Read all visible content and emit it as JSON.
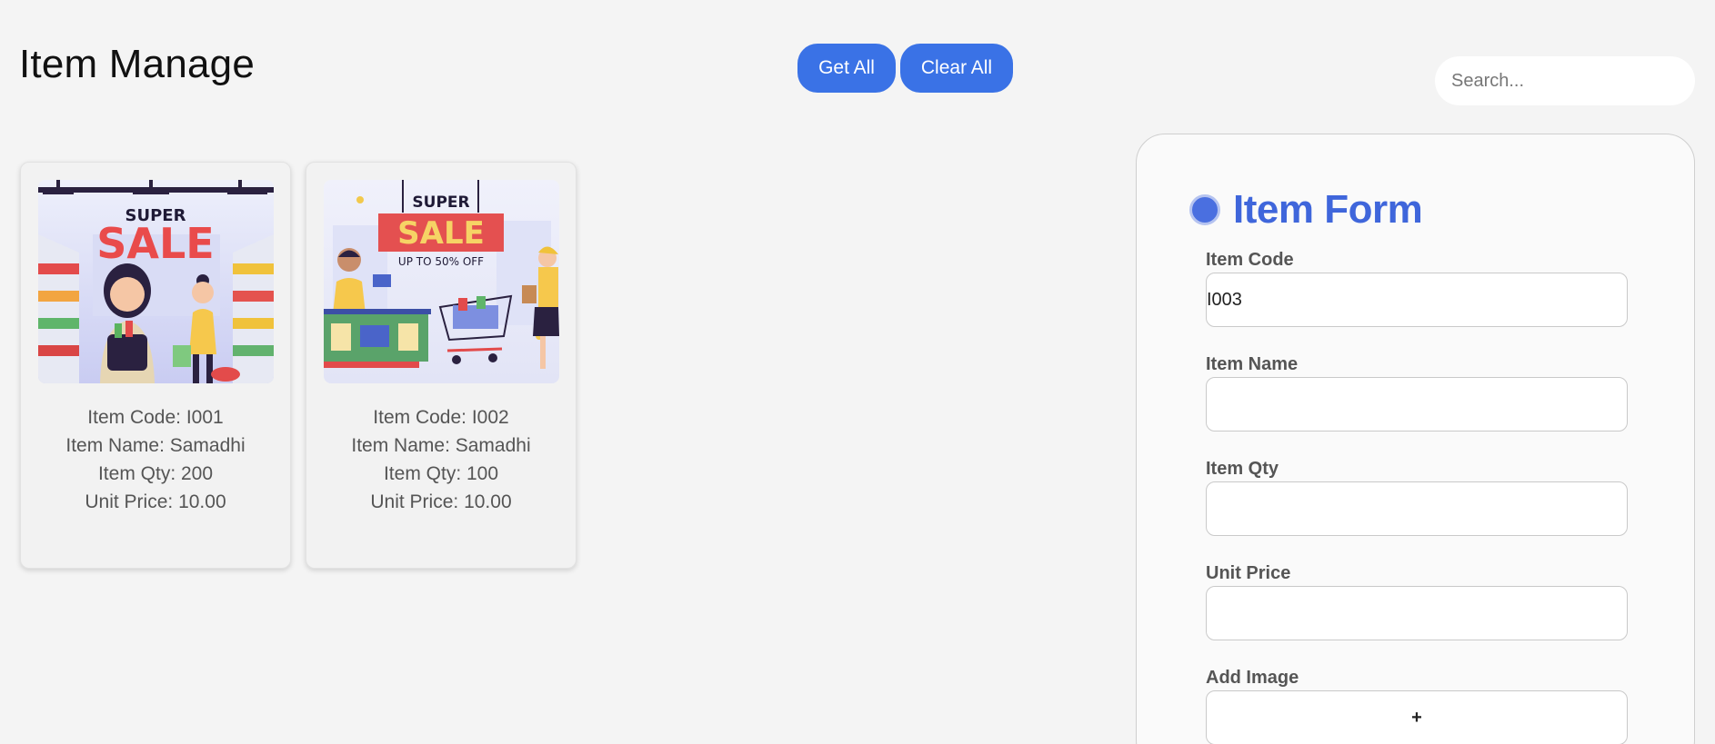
{
  "header": {
    "title": "Item Manage",
    "get_all_label": "Get All",
    "clear_all_label": "Clear All"
  },
  "search": {
    "placeholder": "Search...",
    "icon": "search-icon"
  },
  "items": [
    {
      "code": "Item Code: I001",
      "name": "Item Name: Samadhi",
      "qty": "Item Qty: 200",
      "price": "Unit Price: 10.00",
      "image_text": {
        "line1": "SUPER",
        "line2": "SALE"
      }
    },
    {
      "code": "Item Code: I002",
      "name": "Item Name: Samadhi",
      "qty": "Item Qty: 100",
      "price": "Unit Price: 10.00",
      "image_text": {
        "line1": "SUPER",
        "line2": "SALE",
        "line3": "UP TO 50% OFF"
      }
    }
  ],
  "form": {
    "title": "Item Form",
    "fields": {
      "item_code": {
        "label": "Item Code",
        "value": "I003"
      },
      "item_name": {
        "label": "Item Name",
        "value": ""
      },
      "item_qty": {
        "label": "Item Qty",
        "value": ""
      },
      "unit_price": {
        "label": "Unit Price",
        "value": ""
      },
      "add_image": {
        "label": "Add Image",
        "button": "+"
      }
    }
  },
  "colors": {
    "accent": "#3a72e6",
    "form_title": "#3f66db",
    "background": "#f4f4f4"
  }
}
